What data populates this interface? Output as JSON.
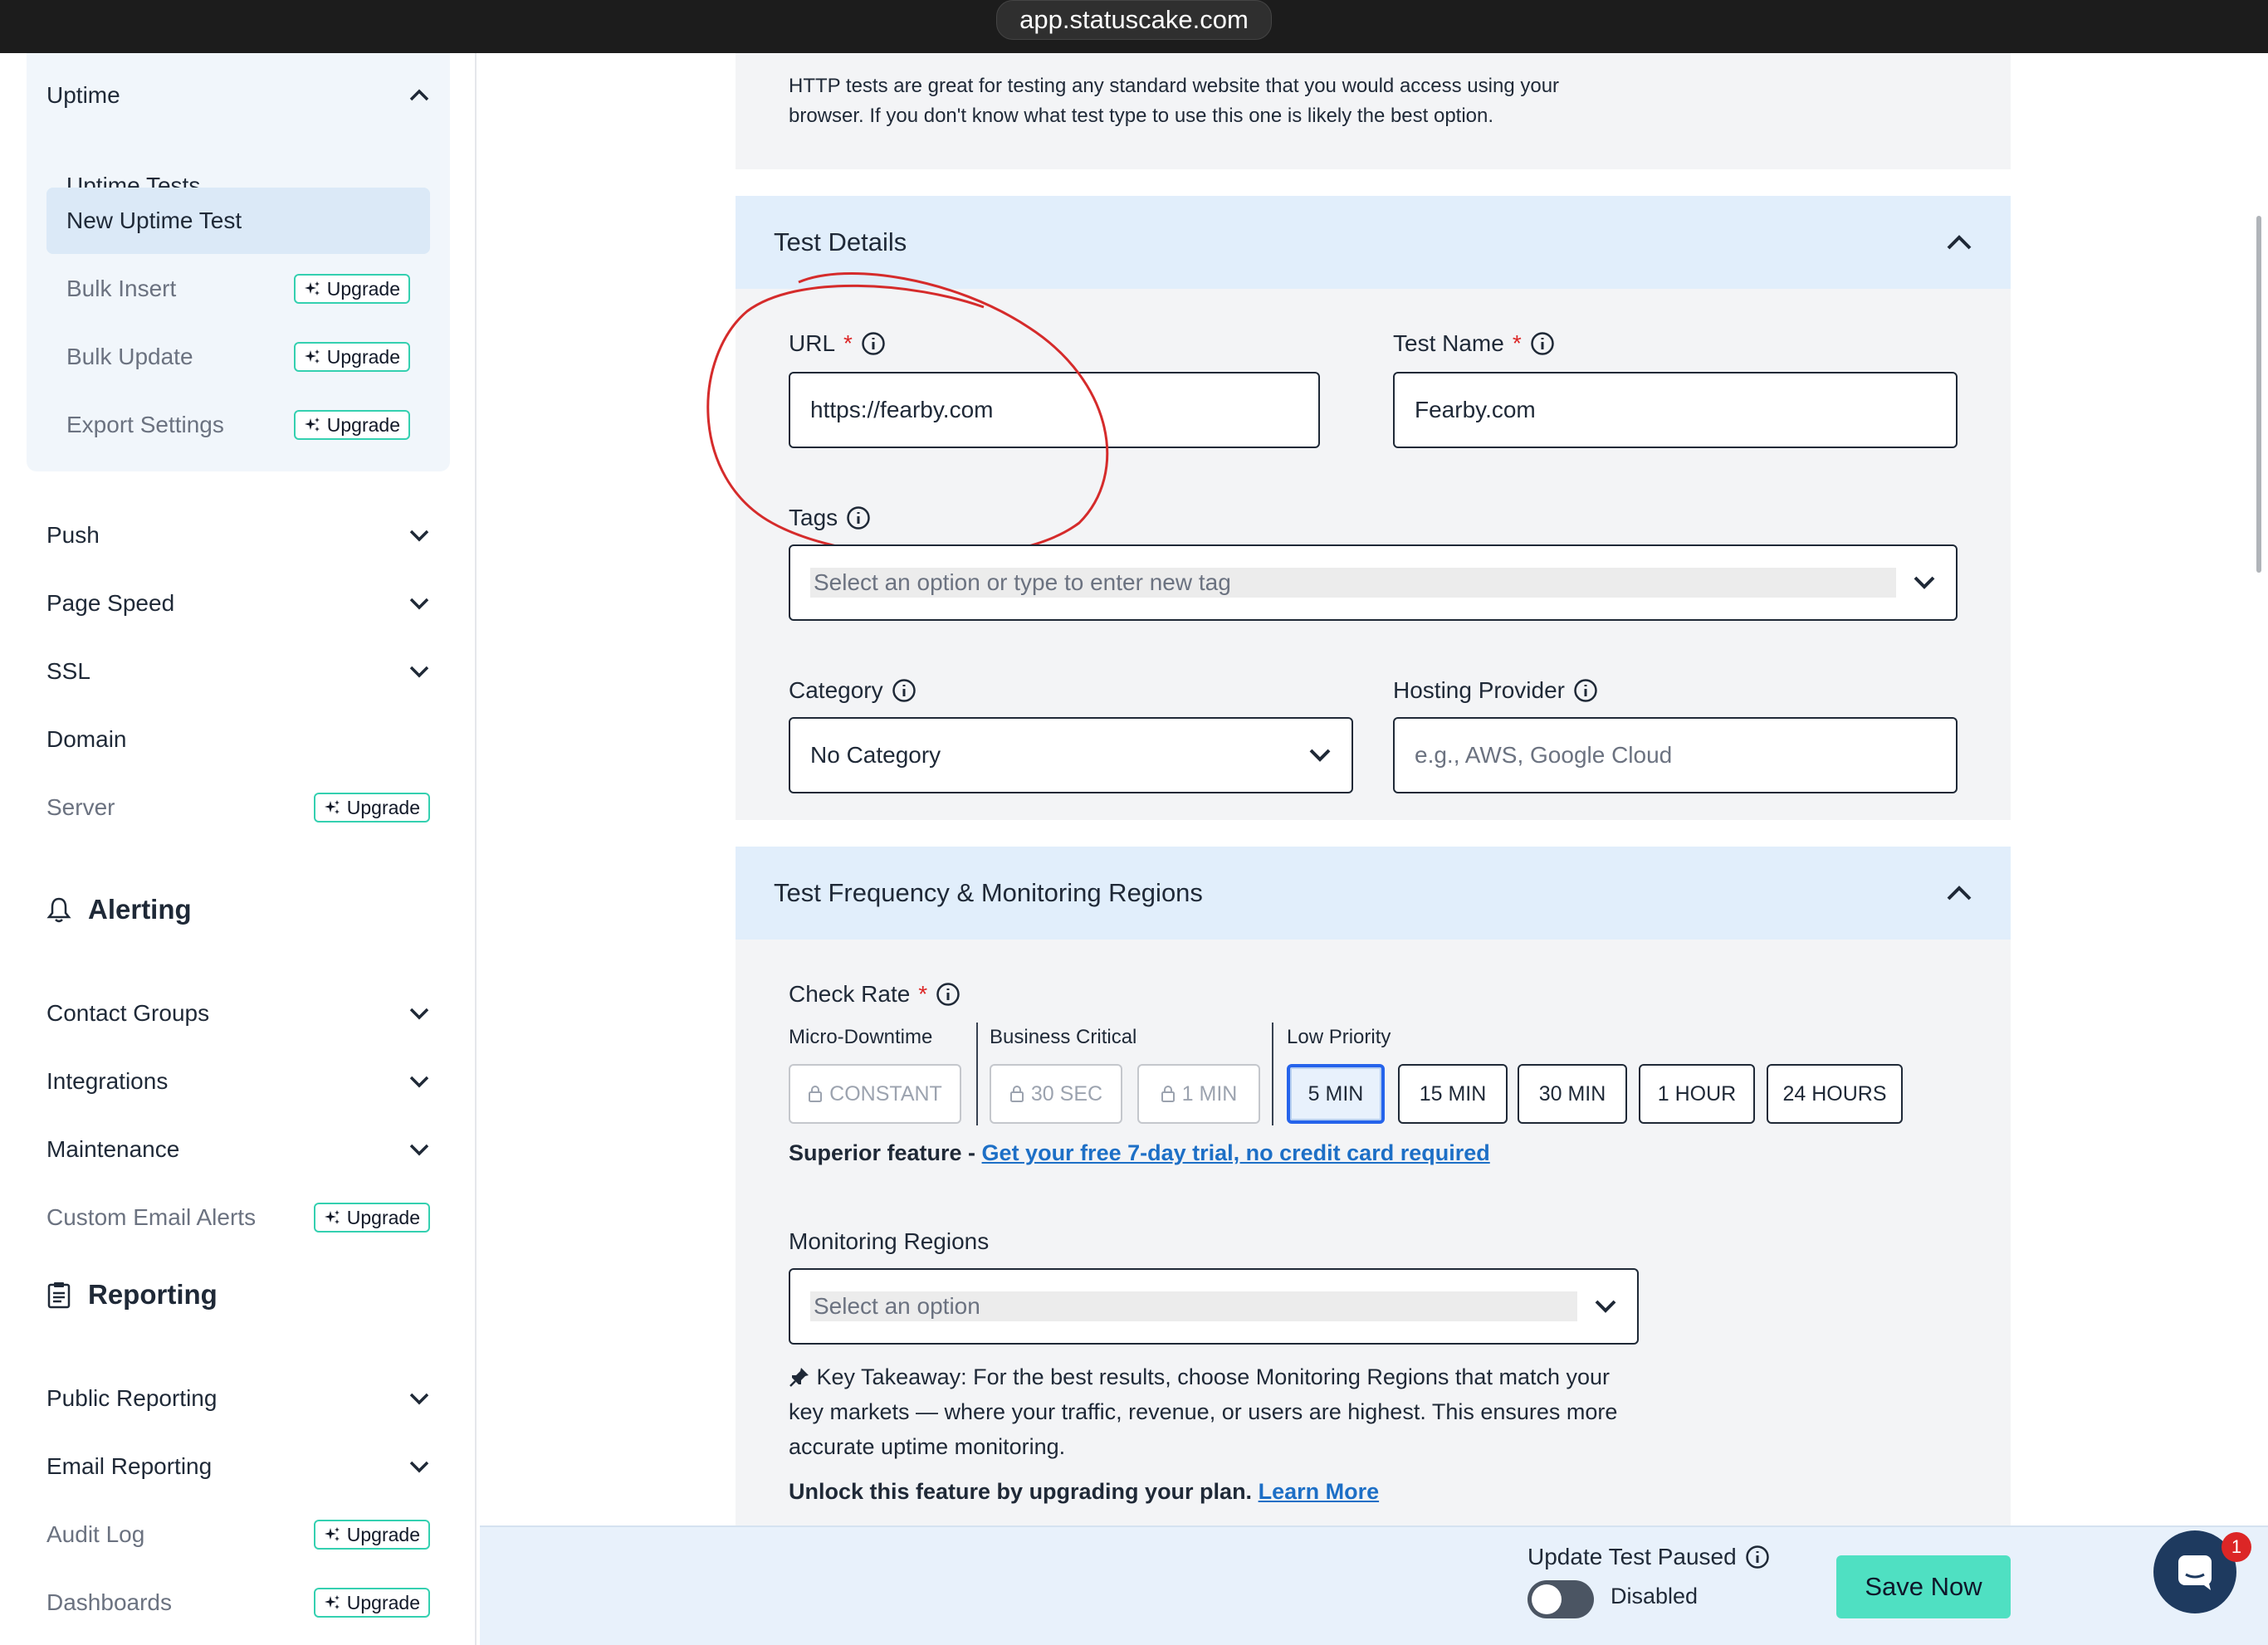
{
  "browser": {
    "url": "app.statuscake.com"
  },
  "sidebar": {
    "uptime": {
      "label": "Uptime",
      "items": [
        {
          "label": "Uptime Tests"
        },
        {
          "label": "New Uptime Test"
        },
        {
          "label": "Bulk Insert",
          "badge": "Upgrade"
        },
        {
          "label": "Bulk Update",
          "badge": "Upgrade"
        },
        {
          "label": "Export Settings",
          "badge": "Upgrade"
        }
      ]
    },
    "monitoring": [
      {
        "label": "Push"
      },
      {
        "label": "Page Speed"
      },
      {
        "label": "SSL"
      },
      {
        "label": "Domain"
      },
      {
        "label": "Server",
        "badge": "Upgrade"
      }
    ],
    "alerting": {
      "heading": "Alerting",
      "items": [
        {
          "label": "Contact Groups"
        },
        {
          "label": "Integrations"
        },
        {
          "label": "Maintenance"
        },
        {
          "label": "Custom Email Alerts",
          "badge": "Upgrade"
        }
      ]
    },
    "reporting": {
      "heading": "Reporting",
      "items": [
        {
          "label": "Public Reporting"
        },
        {
          "label": "Email Reporting"
        },
        {
          "label": "Audit Log",
          "badge": "Upgrade"
        },
        {
          "label": "Dashboards",
          "badge": "Upgrade"
        }
      ]
    }
  },
  "http_intro": {
    "line1": "HTTP tests are great for testing any standard website that you would access using your",
    "line2": "browser. If you don't know what test type to use this one is likely the best option."
  },
  "test_details": {
    "title": "Test Details",
    "url_label": "URL",
    "url_value": "https://fearby.com",
    "name_label": "Test Name",
    "name_value": "Fearby.com",
    "tags_label": "Tags",
    "tags_placeholder": "Select an option or type to enter new tag",
    "category_label": "Category",
    "category_value": "No Category",
    "hosting_label": "Hosting Provider",
    "hosting_placeholder": "e.g., AWS, Google Cloud"
  },
  "frequency": {
    "title": "Test Frequency & Monitoring Regions",
    "check_rate_label": "Check Rate",
    "groups": {
      "micro": "Micro-Downtime",
      "business": "Business Critical",
      "low": "Low Priority"
    },
    "rates": {
      "constant": "CONSTANT",
      "sec30": "30 SEC",
      "min1": "1 MIN",
      "min5": "5 MIN",
      "min15": "15 MIN",
      "min30": "30 MIN",
      "hour1": "1 HOUR",
      "hours24": "24 HOURS"
    },
    "selected_rate": "5 MIN",
    "superior_prefix": "Superior feature - ",
    "superior_link": "Get your free 7-day trial, no credit card required",
    "regions_label": "Monitoring Regions",
    "regions_placeholder": "Select an option",
    "takeaway_line1": "Key Takeaway: For the best results, choose Monitoring Regions that match your",
    "takeaway_line2": "key markets — where your traffic, revenue, or users are highest. This ensures more",
    "takeaway_line3": "accurate uptime monitoring.",
    "unlock_text": "Unlock this feature by upgrading your plan.",
    "learn_more": "Learn More"
  },
  "footer": {
    "paused_label": "Update Test Paused",
    "toggle_state": "Disabled",
    "save_label": "Save Now",
    "chat_badge": "1"
  },
  "colors": {
    "accent": "#4fe0c2",
    "header_blue": "#e1eefb",
    "link": "#1d6fc6",
    "required": "#dc2626"
  }
}
